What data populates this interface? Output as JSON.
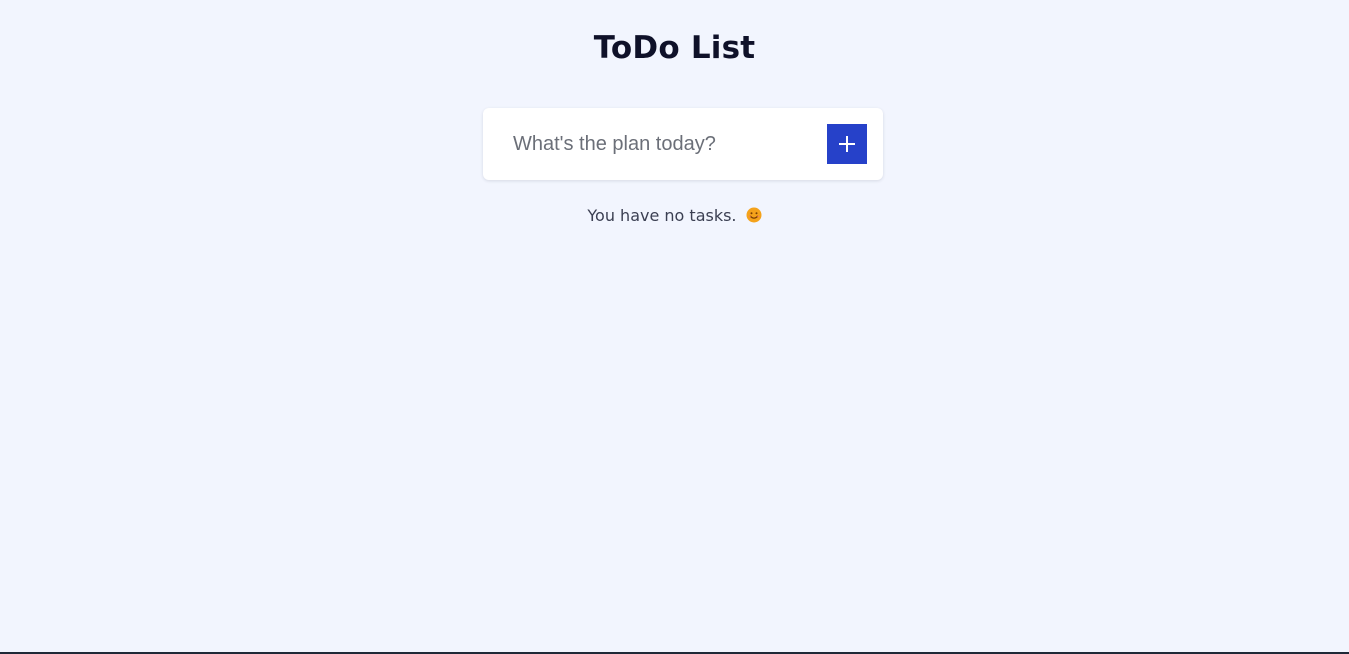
{
  "app": {
    "title": "ToDo List"
  },
  "input": {
    "placeholder": "What's the plan today?",
    "value": ""
  },
  "add_button": {
    "icon": "plus-icon"
  },
  "tasks": [],
  "empty_state": {
    "message": "You have no tasks.",
    "icon": "smiling-face-icon"
  },
  "colors": {
    "background": "#f2f5fe",
    "accent": "#2641c9",
    "title": "#0f1129",
    "text": "#3b3f52",
    "emoji": "#f4a21b"
  }
}
